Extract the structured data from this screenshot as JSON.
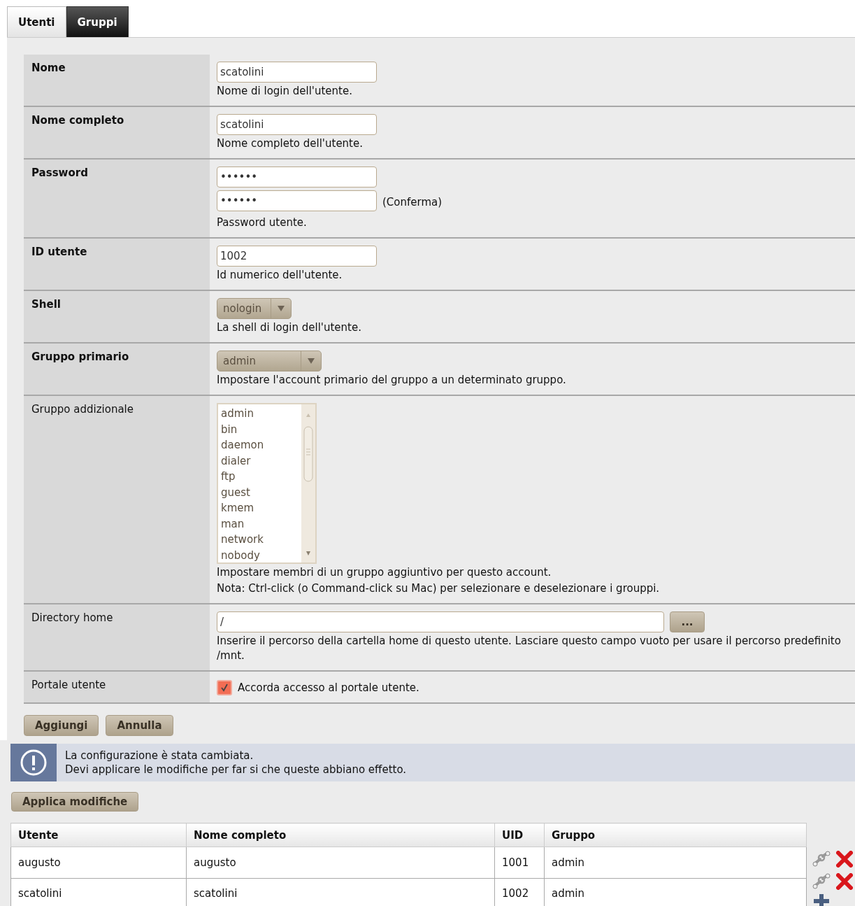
{
  "tabs": [
    {
      "label": "Utenti",
      "selected": true
    },
    {
      "label": "Gruppi",
      "selected": false
    }
  ],
  "form": {
    "rows": [
      {
        "kind": "text",
        "label": "Nome",
        "required": true,
        "value": "scatolini",
        "help": [
          "Nome di login dell'utente."
        ]
      },
      {
        "kind": "text",
        "label": "Nome completo",
        "required": true,
        "value": "scatolini",
        "help": [
          "Nome completo dell'utente."
        ]
      },
      {
        "kind": "password",
        "label": "Password",
        "required": true,
        "value": "••••••",
        "confirm_value": "••••••",
        "confirm_label": "(Conferma)",
        "help": [
          "Password utente."
        ]
      },
      {
        "kind": "text",
        "label": "ID utente",
        "required": true,
        "value": "1002",
        "help": [
          "Id numerico dell'utente."
        ]
      },
      {
        "kind": "select",
        "label": "Shell",
        "required": true,
        "value": "nologin",
        "help": [
          "La shell di login dell'utente."
        ]
      },
      {
        "kind": "select",
        "label": "Gruppo primario",
        "required": true,
        "value": "admin",
        "help": [
          "Impostare l'account primario del gruppo a un determinato gruppo."
        ]
      },
      {
        "kind": "multiselect",
        "label": "Gruppo addizionale",
        "required": false,
        "options": [
          "admin",
          "bin",
          "daemon",
          "dialer",
          "ftp",
          "guest",
          "kmem",
          "man",
          "network",
          "nobody"
        ],
        "help": [
          "Impostare membri di un gruppo aggiuntivo per questo account.",
          "Nota: Ctrl-click (o Command-click su Mac) per selezionare e deselezionare i grouppi."
        ]
      },
      {
        "kind": "path",
        "label": "Directory home",
        "required": false,
        "value": "/",
        "button": "...",
        "help": [
          "Inserire il percorso della cartella home di questo utente. Lasciare questo campo vuoto per usare il percorso predefinito /mnt."
        ]
      },
      {
        "kind": "checkbox",
        "label": "Portale utente",
        "required": false,
        "checked": true,
        "text": "Accorda accesso al portale utente.",
        "help": []
      }
    ],
    "buttons": [
      "Aggiungi",
      "Annulla"
    ]
  },
  "notice": {
    "lines": [
      "La configurazione è stata cambiata.",
      "Devi applicare le modifiche per far si che queste abbiano effetto."
    ],
    "button": "Applica modifiche"
  },
  "table": {
    "columns": [
      "Utente",
      "Nome completo",
      "UID",
      "Gruppo"
    ],
    "rows": [
      [
        "augusto",
        "augusto",
        "1001",
        "admin"
      ],
      [
        "scatolini",
        "scatolini",
        "1002",
        "admin"
      ]
    ]
  }
}
